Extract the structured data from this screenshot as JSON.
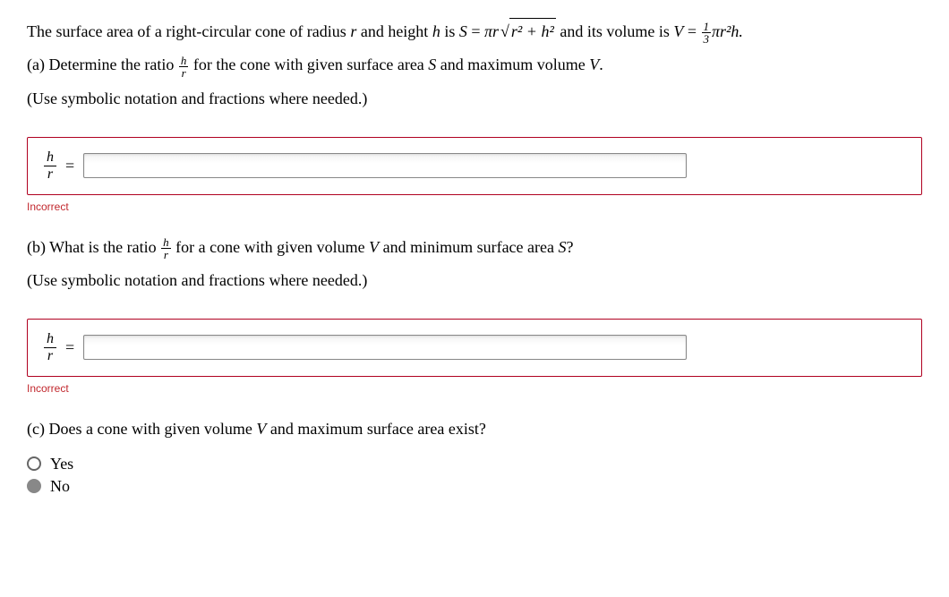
{
  "intro": {
    "prefix": "The surface area of a right-circular cone of radius ",
    "r": "r",
    "mid1": " and height ",
    "h": "h",
    "mid2": " is ",
    "S": "S",
    "eq1": " = ",
    "pi_r": "πr",
    "sqrt_body": "r² + h²",
    "mid3": " and its volume is ",
    "V": "V",
    "eq2": " = ",
    "one": "1",
    "three": "3",
    "pir2h": "πr²h.",
    "period": ""
  },
  "partA": {
    "label": "(a) Determine the ratio ",
    "frac_h": "h",
    "frac_r": "r",
    "rest": " for the cone with given surface area ",
    "S": "S",
    "rest2": " and maximum volume ",
    "V": "V",
    "period": "."
  },
  "hint": "(Use symbolic notation and fractions where needed.)",
  "answerA": {
    "h": "h",
    "r": "r",
    "eq": "=",
    "value": "",
    "feedback": "Incorrect"
  },
  "partB": {
    "label": "(b) What is the ratio ",
    "frac_h": "h",
    "frac_r": "r",
    "rest": " for a cone with given volume ",
    "V": "V",
    "rest2": " and minimum surface area ",
    "S": "S",
    "q": "?"
  },
  "answerB": {
    "h": "h",
    "r": "r",
    "eq": "=",
    "value": "",
    "feedback": "Incorrect"
  },
  "partC": {
    "text1": "(c) Does a cone with given volume ",
    "V": "V",
    "text2": " and maximum surface area exist?",
    "optYes": "Yes",
    "optNo": "No",
    "selected": "No"
  }
}
